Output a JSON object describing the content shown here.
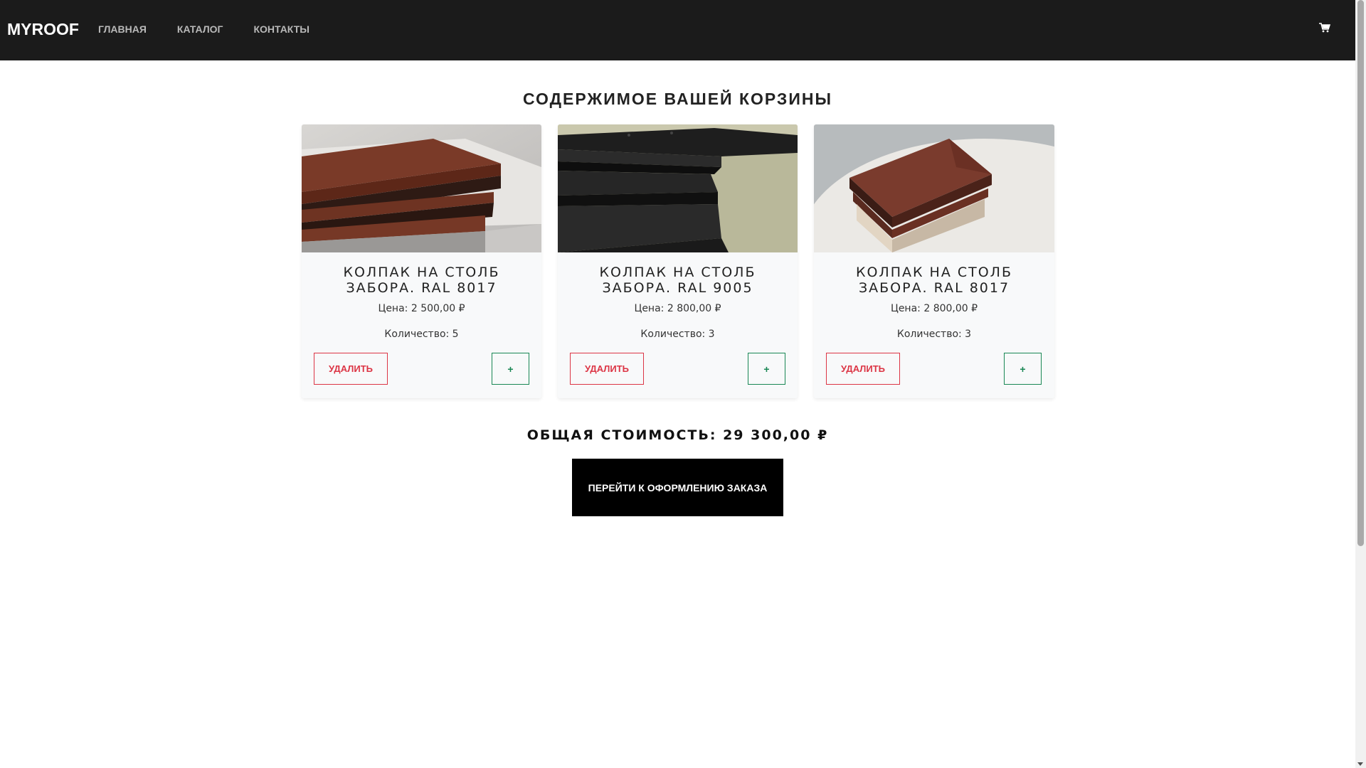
{
  "navbar": {
    "brand": "MYROOF",
    "links": [
      "ГЛАВНАЯ",
      "КАТАЛОГ",
      "КОНТАКТЫ"
    ],
    "cart_icon": "cart-icon"
  },
  "page": {
    "title": "СОДЕРЖИМОЕ ВАШЕЙ КОРЗИНЫ"
  },
  "cart": {
    "items": [
      {
        "title": "КОЛПАК НА СТОЛБ ЗАБОРА. RAL 8017",
        "price": "Цена: 2 500,00 ₽",
        "quantity": "Количество: 5",
        "remove_label": "УДАЛИТЬ",
        "add_label": "+"
      },
      {
        "title": "КОЛПАК НА СТОЛБ ЗАБОРА. RAL 9005",
        "price": "Цена: 2 800,00 ₽",
        "quantity": "Количество: 3",
        "remove_label": "УДАЛИТЬ",
        "add_label": "+"
      },
      {
        "title": "КОЛПАК НА СТОЛБ ЗАБОРА. RAL 8017",
        "price": "Цена: 2 800,00 ₽",
        "quantity": "Количество: 3",
        "remove_label": "УДАЛИТЬ",
        "add_label": "+"
      }
    ],
    "total": "ОБЩАЯ СТОИМОСТЬ: 29 300,00 ₽",
    "checkout_label": "ПЕРЕЙТИ К ОФОРМЛЕНИЮ ЗАКАЗА"
  },
  "colors": {
    "navbar_bg": "#1b1b1b",
    "danger": "#dc3545",
    "success": "#198754",
    "checkout_bg": "#000000"
  }
}
